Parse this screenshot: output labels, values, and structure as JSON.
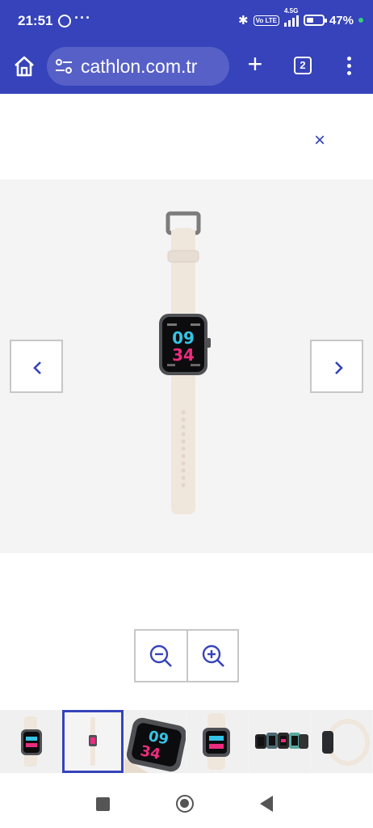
{
  "status_bar": {
    "time": "21:51",
    "more": "···",
    "volte": "Vo LTE",
    "network": "4.5G",
    "battery_percent": "47%",
    "battery_level": 0.47
  },
  "browser": {
    "url": "cathlon.com.tr",
    "tab_count": "2"
  },
  "gallery": {
    "close_label": "×",
    "watch_face_hour": "09",
    "watch_face_minute": "34",
    "thumbnail_count": 6,
    "selected_thumbnail": 2
  },
  "colors": {
    "brand_blue": "#3643BA",
    "watch_strap": "#efe6dc",
    "watch_hour": "#35c3e5",
    "watch_minute": "#ec2c7e"
  }
}
